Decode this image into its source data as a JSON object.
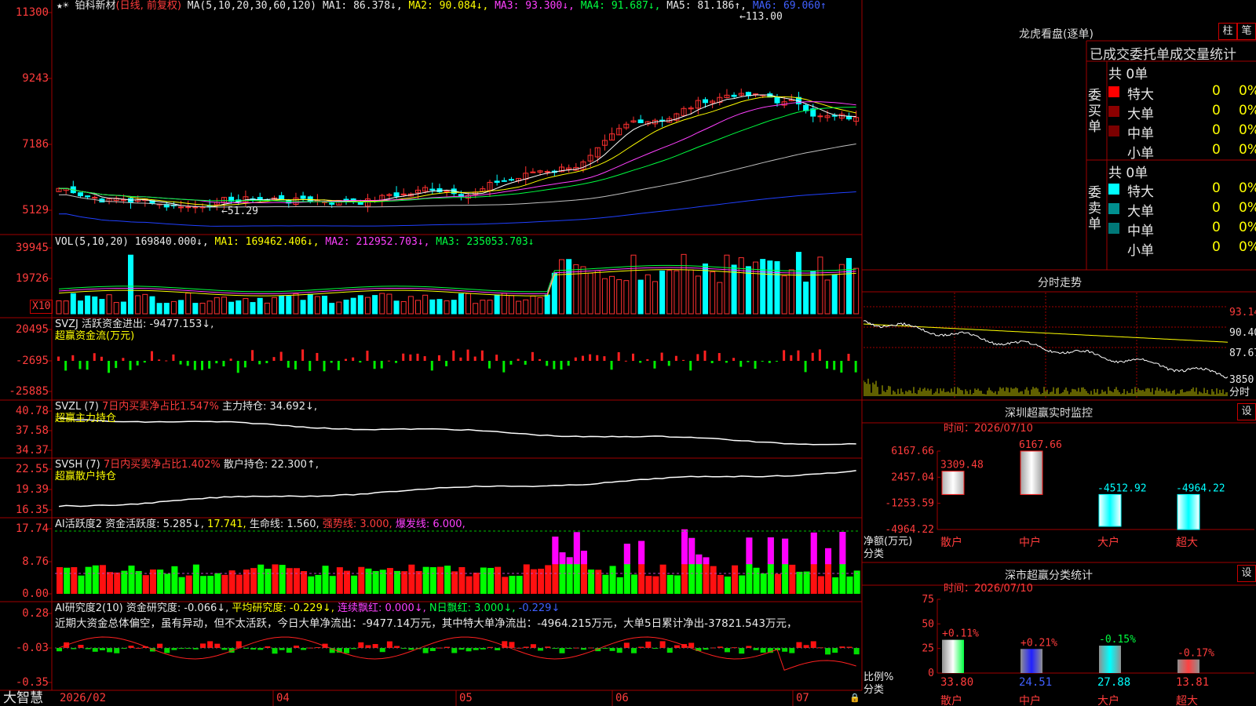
{
  "stock": {
    "name": "铂科新材",
    "period": "(日线, 前复权)",
    "ma_label": "MA(5,10,20,30,60,120)",
    "ma1": "MA1: 86.378↓,",
    "ma2": "MA2: 90.084↓,",
    "ma3": "MA3: 93.300↓,",
    "ma4": "MA4: 91.687↓,",
    "ma5": "MA5: 81.186↑,",
    "ma6": "MA6: 69.060↑",
    "high_mark": "←113.00",
    "low_mark": "←51.29",
    "price_axis": [
      "11300",
      "9243",
      "7186",
      "5129"
    ]
  },
  "vol": {
    "label": "VOL(5,10,20)",
    "value": "169840.000↓,",
    "ma1": "MA1: 169462.406↓,",
    "ma2": "MA2: 212952.703↓,",
    "ma3": "MA3: 235053.703↓",
    "axis": [
      "39945",
      "19726"
    ],
    "unit": "X10"
  },
  "svzj": {
    "label": "SVZJ  活跃资金进出: -9477.153↓,",
    "sub": "超赢资金流(万元)",
    "axis": [
      "20495",
      "-2695",
      "-25885"
    ]
  },
  "svzl": {
    "label": "SVZL (7)",
    "pct": "7日内买卖净占比1.547%",
    "hold": "主力持仓: 34.692↓,",
    "sub": "超赢主力持仓",
    "axis": [
      "40.78",
      "37.58",
      "34.37"
    ]
  },
  "svsh": {
    "label": "SVSH (7)",
    "pct": "7日内买卖净占比1.402%",
    "hold": "散户持仓: 22.300↑,",
    "sub": "超赢散户持仓",
    "axis": [
      "22.55",
      "19.39",
      "16.35"
    ]
  },
  "ai1": {
    "label": "AI活跃度2",
    "a": "资金活跃度: 5.285↓,",
    "b": "17.741,",
    "c": "生命线: 1.560,",
    "d": "强势线: 3.000,",
    "e": "爆发线: 6.000,",
    "axis": [
      "17.74",
      "8.76",
      "0.00"
    ]
  },
  "ai2": {
    "label": "AI研究度2(10)",
    "a": "资金研究度: -0.066↓,",
    "b": "平均研究度: -0.229↓,",
    "c": "连续飘红: 0.000↓,",
    "d": "N日飘红: 3.000↓,",
    "e": "-0.229↓",
    "comment": "近期大资金总体偏空，虽有异动，但不太活跃，今日大单净流出：-9477.14万元，其中特大单净流出：-4964.215万元，大单5日累计净出-37821.543万元，",
    "axis": [
      "0.28",
      "-0.03",
      "-0.35"
    ]
  },
  "footer": {
    "brand": "大智慧",
    "dates": [
      "2026/02",
      "04",
      "05",
      "06",
      "07"
    ]
  },
  "dragon": {
    "title": "龙虎看盘(逐单)",
    "btn1": "柱",
    "btn2": "笔",
    "header": "已成交委托单成交量统计",
    "buy_group": "委买单",
    "sell_group": "委卖单",
    "buy_total": "共 0单",
    "sell_total": "共 0单",
    "buy_rows": [
      {
        "name": "特大",
        "count": "0",
        "pct": "0%",
        "color": "#ff0000"
      },
      {
        "name": "大单",
        "count": "0",
        "pct": "0%",
        "color": "#8b0000"
      },
      {
        "name": "中单",
        "count": "0",
        "pct": "0%",
        "color": "#7a0000"
      },
      {
        "name": "小单",
        "count": "0",
        "pct": "0%",
        "color": "#000000"
      }
    ],
    "sell_rows": [
      {
        "name": "特大",
        "count": "0",
        "pct": "0%",
        "color": "#00ffff"
      },
      {
        "name": "大单",
        "count": "0",
        "pct": "0%",
        "color": "#009090"
      },
      {
        "name": "中单",
        "count": "0",
        "pct": "0%",
        "color": "#007878"
      },
      {
        "name": "小单",
        "count": "0",
        "pct": "0%",
        "color": "#000000"
      }
    ]
  },
  "intraday": {
    "title": "分时走势",
    "axis": [
      "93.14",
      "90.40",
      "87.67",
      "3850"
    ],
    "foot": "分时"
  },
  "sz_monitor": {
    "title": "深圳超赢实时监控",
    "btn": "设",
    "time": "时间：2026/07/10",
    "axis": [
      "6167.66",
      "2457.04",
      "-1253.59",
      "-4964.22"
    ],
    "bars": [
      {
        "cat": "散户",
        "value": 3309.48,
        "label": "3309.48"
      },
      {
        "cat": "中户",
        "value": 6167.66,
        "label": "6167.66"
      },
      {
        "cat": "大户",
        "value": -4512.92,
        "label": "-4512.92"
      },
      {
        "cat": "超大",
        "value": -4964.22,
        "label": "-4964.22"
      }
    ],
    "ylabel": "净额(万元)",
    "xlabel": "分类"
  },
  "sz_classify": {
    "title": "深市超赢分类统计",
    "btn": "设",
    "time": "时间：2026/07/10",
    "axis": [
      "75",
      "50",
      "25",
      "0"
    ],
    "bars": [
      {
        "cat": "散户",
        "ratio": 33.8,
        "ratio_label": "33.80",
        "chg": "+0.11%"
      },
      {
        "cat": "中户",
        "ratio": 24.51,
        "ratio_label": "24.51",
        "chg": "+0.21%"
      },
      {
        "cat": "大户",
        "ratio": 27.88,
        "ratio_label": "27.88",
        "chg": "-0.15%"
      },
      {
        "cat": "超大",
        "ratio": 13.81,
        "ratio_label": "13.81",
        "chg": "-0.17%"
      }
    ],
    "ylabel": "比例%",
    "xlabel": "分类"
  },
  "chart_data": [
    {
      "type": "bar",
      "title": "深圳超赢实时监控",
      "ylabel": "净额(万元)",
      "xlabel": "分类",
      "categories": [
        "散户",
        "中户",
        "大户",
        "超大"
      ],
      "values": [
        3309.48,
        6167.66,
        -4512.92,
        -4964.22
      ],
      "ylim": [
        -4964.22,
        6167.66
      ]
    },
    {
      "type": "bar",
      "title": "深市超赢分类统计",
      "ylabel": "比例%",
      "xlabel": "分类",
      "categories": [
        "散户",
        "中户",
        "大户",
        "超大"
      ],
      "values": [
        33.8,
        24.51,
        27.88,
        13.81
      ],
      "ylim": [
        0,
        75
      ]
    }
  ]
}
